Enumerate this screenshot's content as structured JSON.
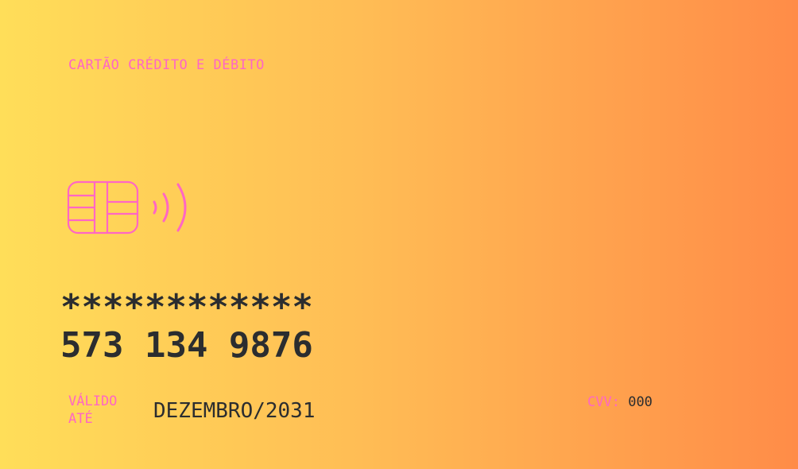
{
  "card": {
    "type_label": "CARTÃO CRÉDITO E DÉBITO",
    "number_masked": "************",
    "number_visible": "573 134 9876",
    "valid_label": "VÁLIDO ATÉ",
    "valid_value": "DEZEMBRO/2031",
    "cvv_label": "CVV:",
    "cvv_value": "000"
  },
  "colors": {
    "gradient_start": "#ffde59",
    "gradient_end": "#ff8c48",
    "accent_pink": "#ff66c4",
    "text_dark": "#2b2d2f"
  },
  "icons": {
    "chip": "chip-icon",
    "contactless": "contactless-icon"
  }
}
